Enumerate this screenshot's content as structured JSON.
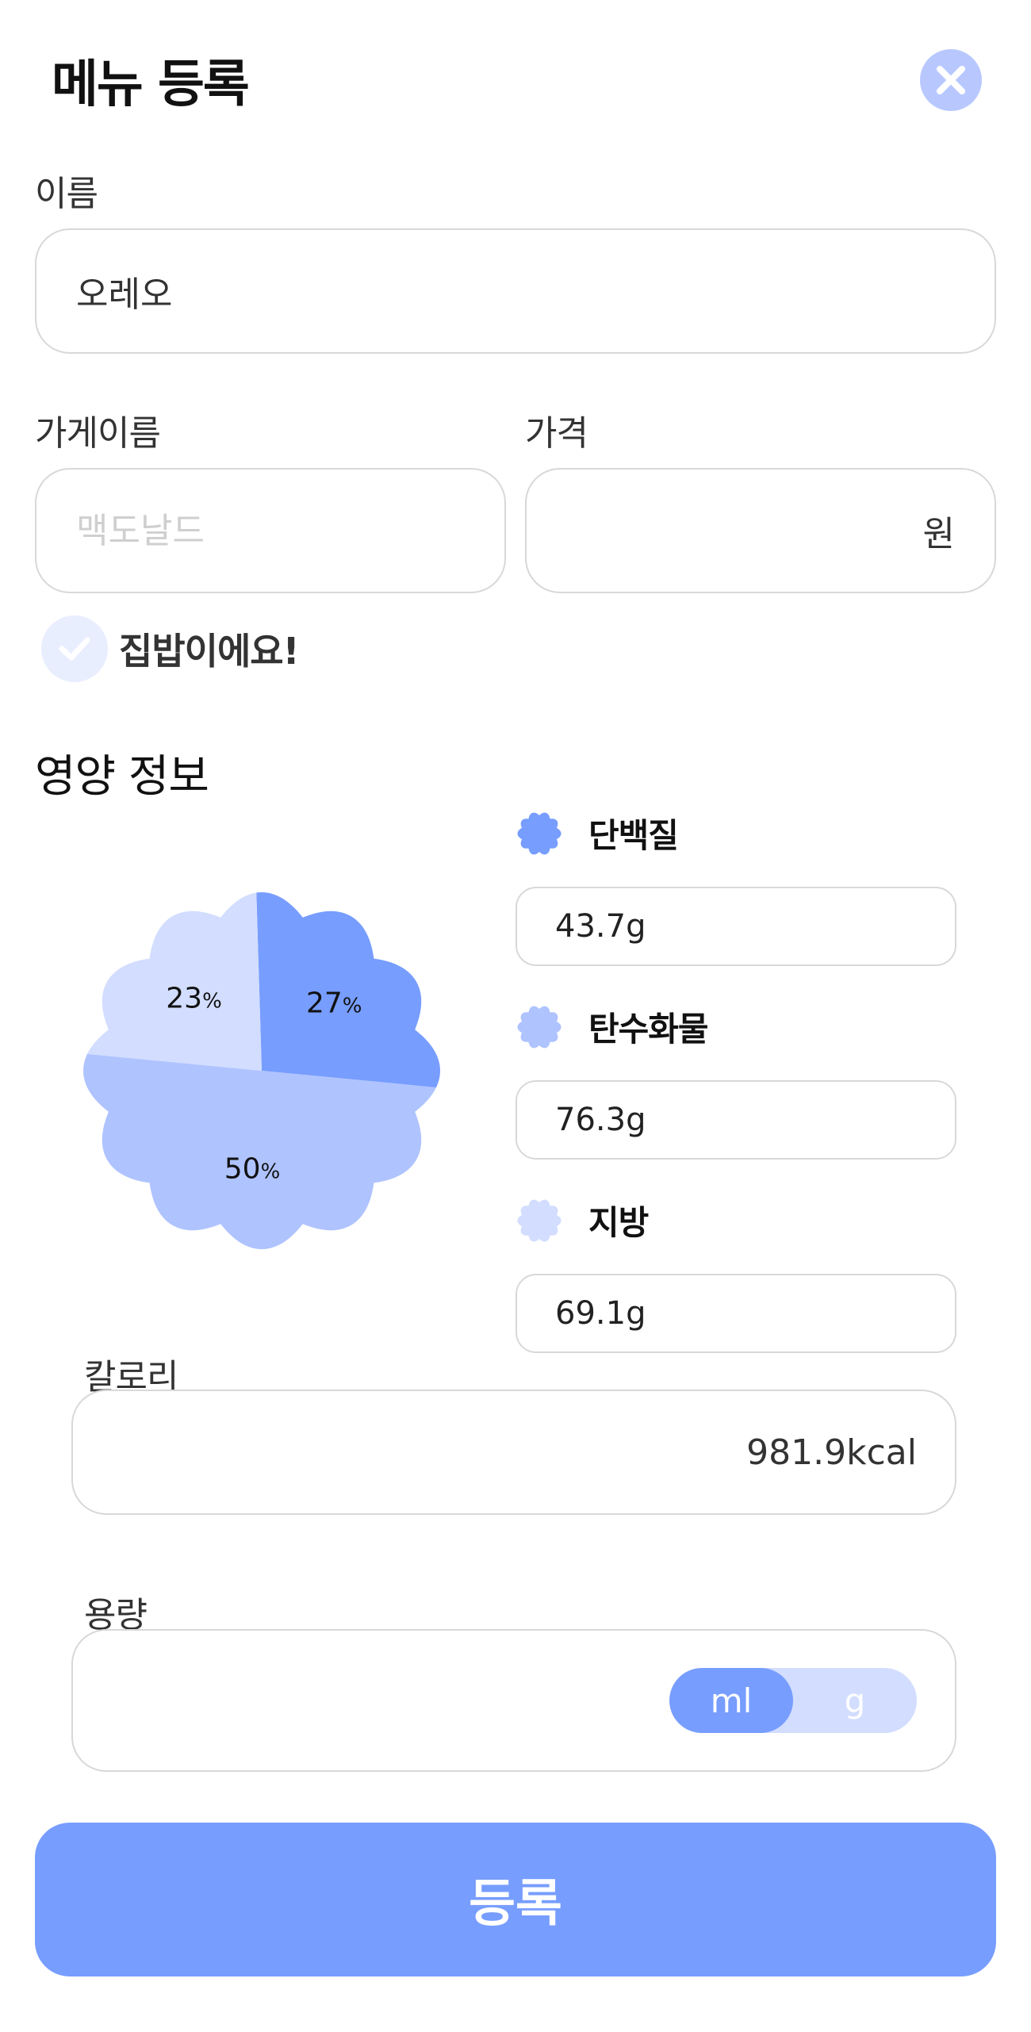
{
  "header": {
    "title": "메뉴 등록",
    "close_icon": "close-icon"
  },
  "form": {
    "name_label": "이름",
    "name_value": "오레오",
    "store_label": "가게이름",
    "store_placeholder": "맥도날드",
    "price_label": "가격",
    "price_value": "",
    "price_unit": "원",
    "homemade_label": "집밥이에요!",
    "homemade_checked": true
  },
  "nutrition": {
    "section_title": "영양 정보",
    "protein": {
      "name": "단백질",
      "value": "43.7g",
      "color": "#779dff"
    },
    "carbs": {
      "name": "탄수화물",
      "value": "76.3g",
      "color": "#afc3ff"
    },
    "fat": {
      "name": "지방",
      "value": "69.1g",
      "color": "#d2ddff"
    }
  },
  "chart_data": {
    "type": "pie",
    "categories": [
      "단백질",
      "탄수화물",
      "지방"
    ],
    "values": [
      27,
      50,
      23
    ],
    "labels": [
      "27",
      "50",
      "23"
    ],
    "unit": "%",
    "colors": [
      "#779dff",
      "#afc3ff",
      "#d2ddff"
    ]
  },
  "calories": {
    "label": "칼로리",
    "value": "981.9kcal"
  },
  "volume": {
    "label": "용량",
    "value": "",
    "unit_options": [
      "ml",
      "g"
    ],
    "selected_unit": "ml"
  },
  "submit_label": "등록"
}
